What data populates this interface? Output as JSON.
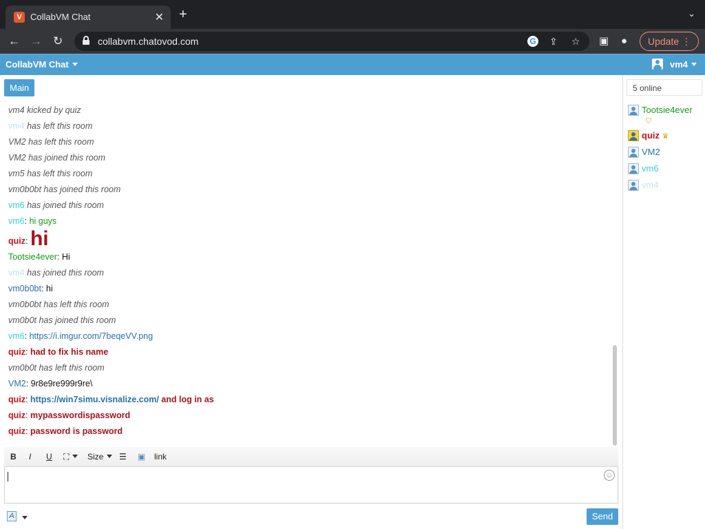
{
  "browser": {
    "tab_title": "CollabVM Chat",
    "tab_favicon": "V",
    "url": "collabvm.chatovod.com",
    "update_label": "Update"
  },
  "app": {
    "title": "CollabVM Chat",
    "current_user": "vm4",
    "room_tab": "Main"
  },
  "messages": [
    {
      "kind": "system",
      "text": "vm4 kicked by quiz"
    },
    {
      "kind": "system",
      "user": "vm4",
      "text": "has left this room"
    },
    {
      "kind": "system",
      "text": "VM2 has left this room"
    },
    {
      "kind": "system",
      "text": "VM2 has joined this room"
    },
    {
      "kind": "system",
      "text": "vm5 has left this room"
    },
    {
      "kind": "system",
      "text": "vm0b0bt has joined this room"
    },
    {
      "kind": "system",
      "user": "vm6",
      "text": "has joined this room"
    },
    {
      "kind": "chat",
      "user": "vm6",
      "text": "hi guys"
    },
    {
      "kind": "chat",
      "user": "quiz",
      "text": "hi"
    },
    {
      "kind": "chat",
      "user": "Tootsie4ever",
      "text": "Hi"
    },
    {
      "kind": "system",
      "user": "vm4",
      "text": "has joined this room"
    },
    {
      "kind": "chat",
      "user": "vm0b0bt",
      "text": "hi"
    },
    {
      "kind": "system",
      "text": "vm0b0bt has left this room"
    },
    {
      "kind": "system",
      "text": "vm0b0t has joined this room"
    },
    {
      "kind": "chat",
      "user": "vm6",
      "text": "https://i.imgur.com/7beqeVV.png"
    },
    {
      "kind": "chat",
      "user": "quiz",
      "text": "had to fix his name"
    },
    {
      "kind": "system",
      "text": "vm0b0t has left this room"
    },
    {
      "kind": "chat",
      "user": "VM2",
      "text": "9r8e9re999r9re\\"
    },
    {
      "kind": "chat",
      "user": "quiz",
      "link": "https://win7simu.visnalize.com/",
      "text": "and log in as"
    },
    {
      "kind": "chat",
      "user": "quiz",
      "text": "mypasswordispassword"
    },
    {
      "kind": "chat",
      "user": "quiz",
      "text": "password is password"
    }
  ],
  "editor": {
    "bold": "B",
    "italic": "I",
    "underline": "U",
    "size": "Size",
    "link": "link",
    "send": "Send",
    "font_glyph": "A"
  },
  "sidebar": {
    "online_count": "5 online",
    "users": [
      {
        "name": "Tootsie4ever",
        "badge": "shield-icon"
      },
      {
        "name": "quiz",
        "badge": "crown-icon"
      },
      {
        "name": "VM2"
      },
      {
        "name": "vm6"
      },
      {
        "name": "vm4"
      }
    ]
  },
  "colors": {
    "accent": "#4d9fd1",
    "moderator": "#1a9a1a",
    "admin": "#c4131b",
    "link": "#2b6fa6",
    "vm6": "#35d0d8",
    "vm4": "#b9e9ee"
  }
}
